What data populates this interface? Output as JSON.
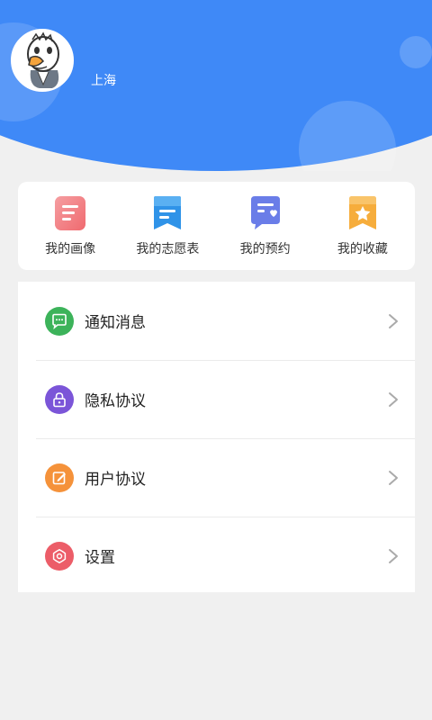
{
  "profile": {
    "location": "上海",
    "avatar_icon": "duck-cartoon-avatar"
  },
  "quick_actions": [
    {
      "label": "我的画像",
      "icon": "portrait-doc-icon",
      "color": "#f06a6f"
    },
    {
      "label": "我的志愿表",
      "icon": "bookmark-list-icon",
      "color": "#2f93e8"
    },
    {
      "label": "我的预约",
      "icon": "appointment-icon",
      "color": "#6a7de8"
    },
    {
      "label": "我的收藏",
      "icon": "star-bookmark-icon",
      "color": "#f6ad3c"
    }
  ],
  "menu": [
    {
      "label": "通知消息",
      "icon": "message-icon",
      "color": "#3cb35a"
    },
    {
      "label": "隐私协议",
      "icon": "lock-icon",
      "color": "#7b55d8"
    },
    {
      "label": "用户协议",
      "icon": "edit-icon",
      "color": "#f5923a"
    },
    {
      "label": "设置",
      "icon": "gear-icon",
      "color": "#ec5d68"
    }
  ],
  "colors": {
    "header": "#3f89f7",
    "background": "#f0f0f0"
  }
}
